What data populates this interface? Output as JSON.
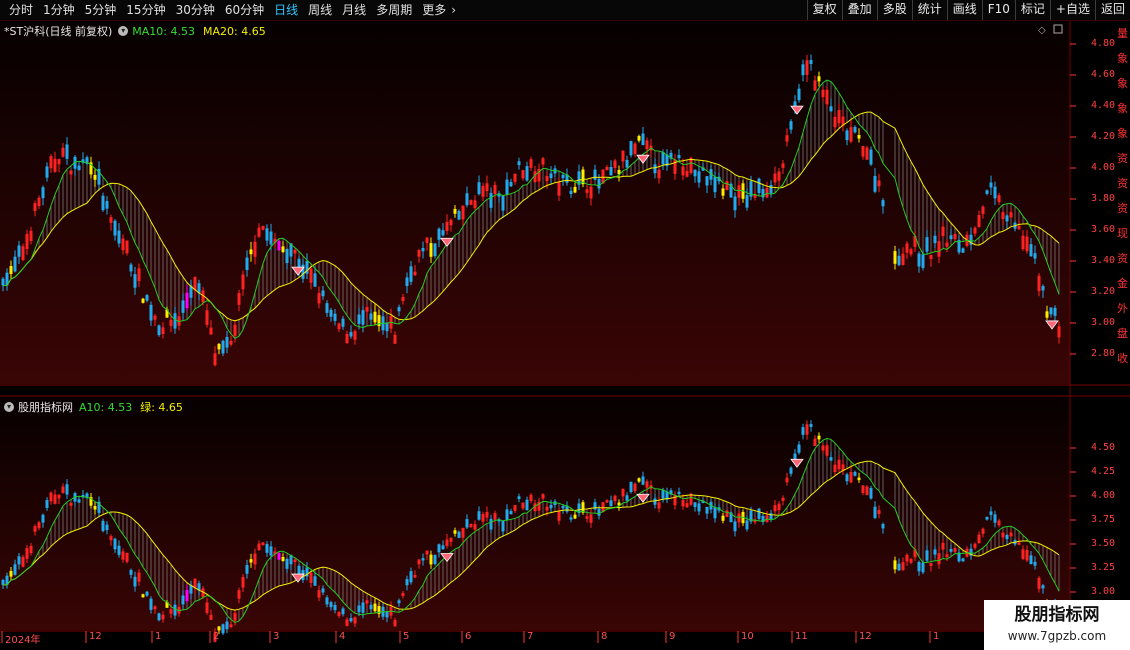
{
  "toolbar": {
    "periods": [
      "分时",
      "1分钟",
      "5分钟",
      "15分钟",
      "30分钟",
      "60分钟",
      "日线",
      "周线",
      "月线",
      "多周期",
      "更多"
    ],
    "active_period": "日线",
    "more_arrow": "›",
    "buttons": [
      "复权",
      "叠加",
      "多股",
      "统计",
      "画线",
      "F10",
      "标记",
      "+自选",
      "返回"
    ]
  },
  "upper_panel": {
    "title": "*ST沪科(日线 前复权)",
    "ma10_label": "MA10: 4.53",
    "ma20_label": "MA20: 4.65",
    "price_ticks": [
      "4.80",
      "4.60",
      "4.40",
      "4.20",
      "4.00",
      "3.80",
      "3.60",
      "3.40",
      "3.20",
      "3.00",
      "2.80"
    ]
  },
  "lower_panel": {
    "title": "股朋指标网",
    "a10_label": "A10: 4.53",
    "green_label": "绿: 4.65",
    "price_ticks": [
      "4.50",
      "4.25",
      "4.00",
      "3.75",
      "3.50",
      "3.25",
      "3.00"
    ]
  },
  "time_axis": {
    "labels": [
      "2024年",
      "12",
      "1",
      "2",
      "3",
      "4",
      "5",
      "6",
      "7",
      "8",
      "9",
      "10",
      "11",
      "12",
      "1"
    ]
  },
  "side_glyphs": [
    "量",
    "象",
    "象",
    "象",
    "象",
    "资",
    "资",
    "资",
    "现",
    "资",
    "金",
    "外",
    "盘",
    "收"
  ],
  "watermark": {
    "title": "股朋指标网",
    "url": "www.7gpzb.com"
  },
  "colors": {
    "up_candle": "#ff2222",
    "down_candle": "#22aaee",
    "signal_yellow": "#ffee00",
    "signal_magenta": "#ff00ff",
    "ma_yellow": "#f0f000",
    "ma_green": "#22cc22",
    "axis_red": "#ff3333"
  }
}
